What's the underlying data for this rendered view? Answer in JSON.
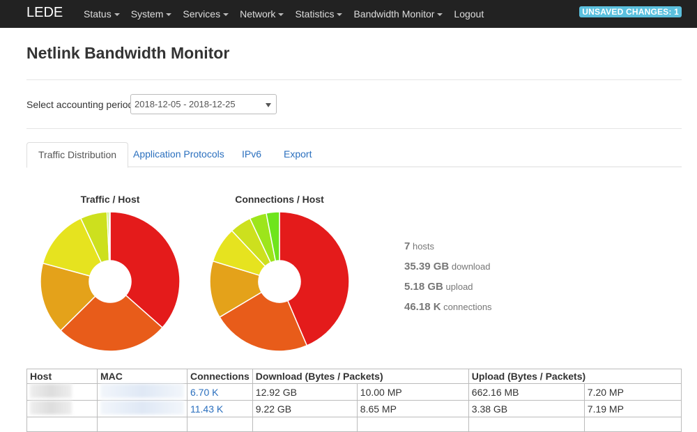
{
  "navbar": {
    "brand": "LEDE",
    "items": [
      {
        "label": "Status",
        "dropdown": true
      },
      {
        "label": "System",
        "dropdown": true
      },
      {
        "label": "Services",
        "dropdown": true
      },
      {
        "label": "Network",
        "dropdown": true
      },
      {
        "label": "Statistics",
        "dropdown": true
      },
      {
        "label": "Bandwidth Monitor",
        "dropdown": true
      },
      {
        "label": "Logout",
        "dropdown": false
      }
    ],
    "badge": "UNSAVED CHANGES: 1"
  },
  "page": {
    "title": "Netlink Bandwidth Monitor",
    "period_label": "Select accounting period:",
    "period_value": "2018-12-05 - 2018-12-25"
  },
  "tabs": [
    {
      "label": "Traffic Distribution",
      "active": true
    },
    {
      "label": "Application Protocols",
      "active": false
    },
    {
      "label": "IPv6",
      "active": false
    },
    {
      "label": "Export",
      "active": false
    }
  ],
  "chart_data": [
    {
      "type": "pie",
      "title": "Traffic / Host",
      "donut": true,
      "values": [
        12.92,
        9.22,
        5.9,
        4.9,
        2.2,
        0.15,
        0.1
      ],
      "colors": [
        "#e41b1b",
        "#e85c1a",
        "#e4a21a",
        "#e6e31f",
        "#cde01e",
        "#9de51b",
        "#6ee51c"
      ]
    },
    {
      "type": "pie",
      "title": "Connections / Host",
      "donut": true,
      "values": [
        20.0,
        10.5,
        6.1,
        3.8,
        2.3,
        1.8,
        1.4
      ],
      "colors": [
        "#e41b1b",
        "#e85c1a",
        "#e4a21a",
        "#e6e31f",
        "#cde01e",
        "#9de51b",
        "#6ee51c"
      ]
    }
  ],
  "stats": [
    {
      "value": "7",
      "label": "hosts"
    },
    {
      "value": "35.39 GB",
      "label": "download"
    },
    {
      "value": "5.18 GB",
      "label": "upload"
    },
    {
      "value": "46.18 K",
      "label": "connections"
    }
  ],
  "table": {
    "headers": [
      "Host",
      "MAC",
      "Connections",
      "Download (Bytes / Packets)",
      "Upload (Bytes / Packets)"
    ],
    "rows": [
      {
        "connections": "6.70 K",
        "dl_bytes": "12.92 GB",
        "dl_packets": "10.00 MP",
        "ul_bytes": "662.16 MB",
        "ul_packets": "7.20 MP"
      },
      {
        "connections": "11.43 K",
        "dl_bytes": "9.22 GB",
        "dl_packets": "8.65 MP",
        "ul_bytes": "3.38 GB",
        "ul_packets": "7.19 MP"
      },
      {
        "connections": "",
        "dl_bytes": "",
        "dl_packets": "",
        "ul_bytes": "",
        "ul_packets": ""
      }
    ]
  }
}
